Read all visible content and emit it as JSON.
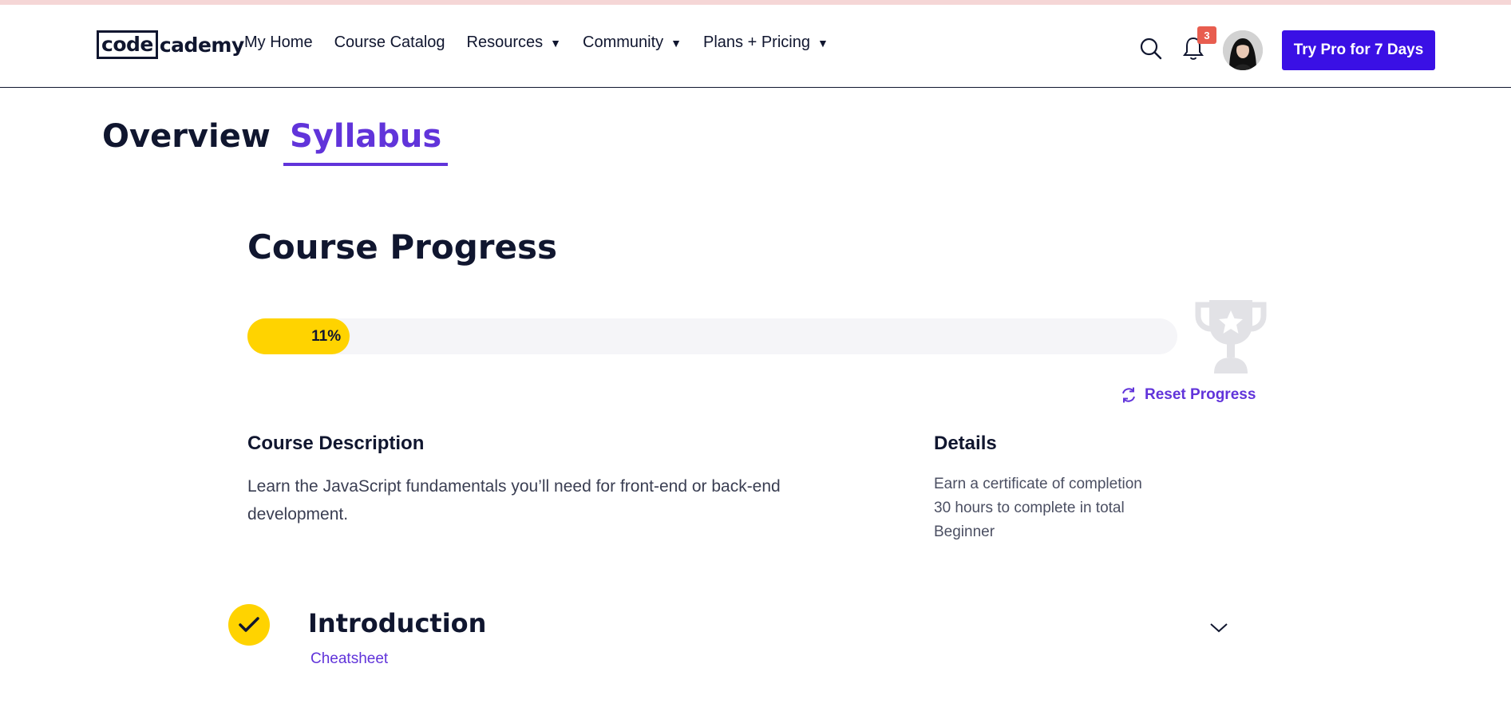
{
  "header": {
    "logo_boxed": "code",
    "logo_rest": "cademy",
    "nav": [
      {
        "label": "My Home",
        "has_caret": false
      },
      {
        "label": "Course Catalog",
        "has_caret": false
      },
      {
        "label": "Resources",
        "has_caret": true
      },
      {
        "label": "Community",
        "has_caret": true
      },
      {
        "label": "Plans + Pricing",
        "has_caret": true
      }
    ],
    "caret_glyph": "▼",
    "notification_count": "3",
    "pro_button_label": "Try Pro for 7 Days",
    "icons": [
      "search-icon",
      "bell-icon",
      "avatar"
    ]
  },
  "tabs": [
    {
      "label": "Overview",
      "active": false
    },
    {
      "label": "Syllabus",
      "active": true
    }
  ],
  "progress": {
    "title": "Course Progress",
    "percent": 11,
    "percent_label": "11%",
    "reset_label": "Reset Progress",
    "icons": [
      "trophy-icon",
      "reset-icon"
    ]
  },
  "description": {
    "heading": "Course Description",
    "text": "Learn the JavaScript fundamentals you’ll need for front-end or back-end development."
  },
  "details": {
    "heading": "Details",
    "items": [
      "Earn a certificate of completion",
      "30 hours to complete in total",
      "Beginner"
    ]
  },
  "modules": [
    {
      "title": "Introduction",
      "link": "Cheatsheet",
      "completed": true
    }
  ],
  "colors": {
    "brand": "#3a10e5",
    "accent_purple": "#6134da",
    "progress_yellow": "#ffd300",
    "navy": "#10162f",
    "badge_red": "#e85d4f"
  }
}
